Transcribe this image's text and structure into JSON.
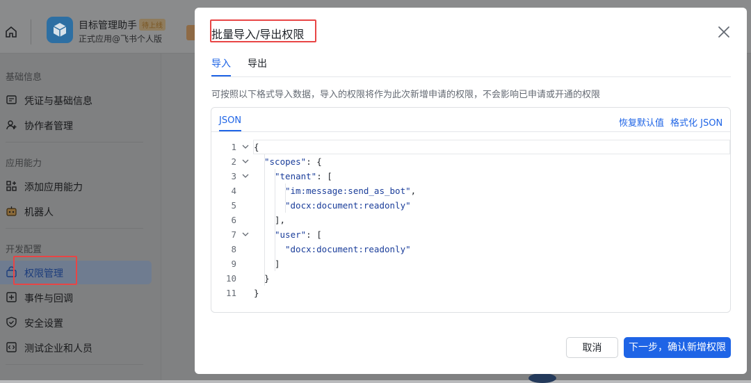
{
  "app": {
    "name": "目标管理助手",
    "badge": "待上线",
    "subtitle": "正式应用@飞书个人版"
  },
  "sidebar": {
    "groups": [
      {
        "label": "基础信息",
        "items": [
          {
            "label": "凭证与基础信息",
            "icon": "credential-icon"
          },
          {
            "label": "协作者管理",
            "icon": "collaborator-icon"
          }
        ]
      },
      {
        "label": "应用能力",
        "items": [
          {
            "label": "添加应用能力",
            "icon": "add-capability-icon"
          },
          {
            "label": "机器人",
            "icon": "robot-icon"
          }
        ]
      },
      {
        "label": "开发配置",
        "items": [
          {
            "label": "权限管理",
            "icon": "permission-icon",
            "active": true
          },
          {
            "label": "事件与回调",
            "icon": "event-icon"
          },
          {
            "label": "安全设置",
            "icon": "shield-icon"
          },
          {
            "label": "测试企业和人员",
            "icon": "test-org-icon"
          }
        ]
      }
    ]
  },
  "modal": {
    "title": "批量导入/导出权限",
    "tabs": [
      {
        "label": "导入",
        "active": true
      },
      {
        "label": "导出",
        "active": false
      }
    ],
    "description": "可按照以下格式导入数据，导入的权限将作为此次新增申请的权限，不会影响已申请或开通的权限",
    "editor": {
      "tab_label": "JSON",
      "restore_default": "恢复默认值",
      "format_json": "格式化 JSON",
      "lines": [
        {
          "n": "1",
          "text": "{",
          "fold": true,
          "indent": 0
        },
        {
          "n": "2",
          "text": "\"scopes\": {",
          "fold": true,
          "indent": 1
        },
        {
          "n": "3",
          "text": "\"tenant\": [",
          "fold": true,
          "indent": 2
        },
        {
          "n": "4",
          "text": "\"im:message:send_as_bot\",",
          "fold": false,
          "indent": 3
        },
        {
          "n": "5",
          "text": "\"docx:document:readonly\"",
          "fold": false,
          "indent": 3
        },
        {
          "n": "6",
          "text": "],",
          "fold": false,
          "indent": 2
        },
        {
          "n": "7",
          "text": "\"user\": [",
          "fold": true,
          "indent": 2
        },
        {
          "n": "8",
          "text": "\"docx:document:readonly\"",
          "fold": false,
          "indent": 3
        },
        {
          "n": "9",
          "text": "]",
          "fold": false,
          "indent": 2
        },
        {
          "n": "10",
          "text": "}",
          "fold": false,
          "indent": 1
        },
        {
          "n": "11",
          "text": "}",
          "fold": false,
          "indent": 0
        }
      ]
    },
    "buttons": {
      "cancel": "取消",
      "confirm": "下一步，确认新增权限"
    }
  },
  "colors": {
    "accent": "#1e64e6",
    "annotation": "#e84545"
  }
}
